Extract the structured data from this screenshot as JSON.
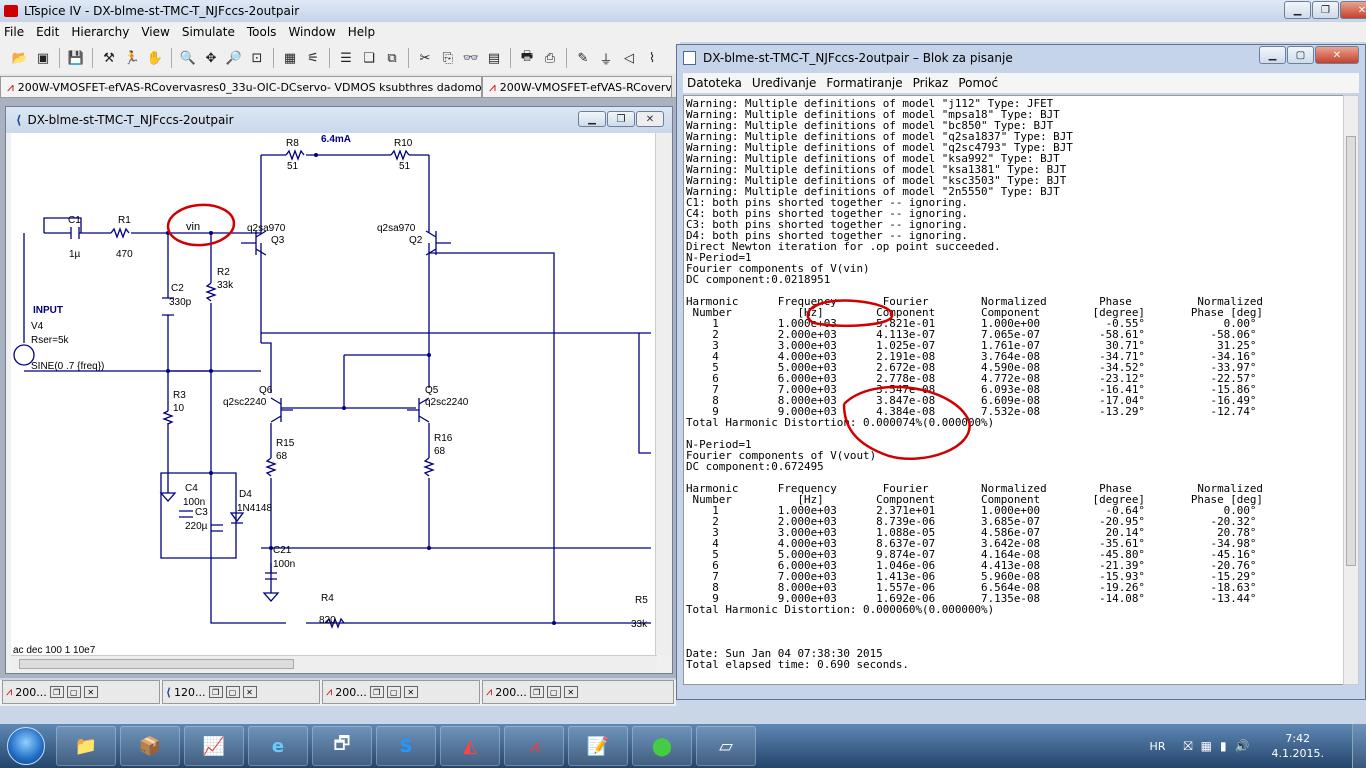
{
  "app": {
    "title": "LTspice IV - DX-blme-st-TMC-T_NJFccs-2outpair",
    "menu": [
      "File",
      "Edit",
      "Hierarchy",
      "View",
      "Simulate",
      "Tools",
      "Window",
      "Help"
    ]
  },
  "doc_tabs": [
    "200W-VMOSFET-efVAS-RCovervasres0_33u-OIC-DCservo- VDMOS ksubthres dadomodels[2]",
    "200W-VMOSFET-efVAS-RCoverv"
  ],
  "schematic": {
    "title": "DX-blme-st-TMC-T_NJFccs-2outpair",
    "labels": {
      "R8": "R8",
      "R8v": "51",
      "current": "6.4mA",
      "R10": "R10",
      "R10v": "51",
      "C1": "C1",
      "C1v": "1µ",
      "R1": "R1",
      "R1v": "470",
      "vin": "vin",
      "Q3m": "q2sa970",
      "Q3": "Q3",
      "Q2m": "q2sa970",
      "Q2": "Q2",
      "C2": "C2",
      "C2v": "330p",
      "R2": "R2",
      "R2v": "33k",
      "input": "INPUT",
      "V4": "V4",
      "rser": "Rser=5k",
      "sine": "SINE(0 .7 {freq})",
      "R3": "R3",
      "R3v": "10",
      "Q6": "Q6",
      "Q6m": "q2sc2240",
      "Q5": "Q5",
      "Q5m": "q2sc2240",
      "R15": "R15",
      "R15v": "68",
      "R16": "R16",
      "R16v": "68",
      "C4": "C4",
      "C4v": "100n",
      "C3": "C3",
      "C3v": "220µ",
      "D4": "D4",
      "D4m": "1N4148",
      "C21": "C21",
      "C21v": "100n",
      "R4": "R4",
      "R4v": "820",
      "R5": "R5",
      "R5v": "33k",
      "ac": "ac dec 100 1 10e7"
    }
  },
  "bottom_tabs": [
    "200...",
    "120...",
    "200...",
    "200..."
  ],
  "notepad": {
    "title": "DX-blme-st-TMC-T_NJFccs-2outpair – Blok za pisanje",
    "menu": [
      "Datoteka",
      "Uređivanje",
      "Formatiranje",
      "Prikaz",
      "Pomoć"
    ],
    "text": "Warning: Multiple definitions of model \"j112\" Type: JFET\nWarning: Multiple definitions of model \"mpsa18\" Type: BJT\nWarning: Multiple definitions of model \"bc850\" Type: BJT\nWarning: Multiple definitions of model \"q2sa1837\" Type: BJT\nWarning: Multiple definitions of model \"q2sc4793\" Type: BJT\nWarning: Multiple definitions of model \"ksa992\" Type: BJT\nWarning: Multiple definitions of model \"ksa1381\" Type: BJT\nWarning: Multiple definitions of model \"ksc3503\" Type: BJT\nWarning: Multiple definitions of model \"2n5550\" Type: BJT\nC1: both pins shorted together -- ignoring.\nC4: both pins shorted together -- ignoring.\nC3: both pins shorted together -- ignoring.\nD4: both pins shorted together -- ignoring.\nDirect Newton iteration for .op point succeeded.\nN-Period=1\nFourier components of V(vin)\nDC component:0.0218951\n\nHarmonic      Frequency       Fourier        Normalized        Phase          Normalized\n Number          [Hz]        Component       Component        [degree]       Phase [deg]\n    1         1.000e+03      5.821e-01       1.000e+00          -0.55°            0.00°\n    2         2.000e+03      4.113e-07       7.065e-07         -58.61°          -58.06°\n    3         3.000e+03      1.025e-07       1.761e-07          30.71°           31.25°\n    4         4.000e+03      2.191e-08       3.764e-08         -34.71°          -34.16°\n    5         5.000e+03      2.672e-08       4.590e-08         -34.52°          -33.97°\n    6         6.000e+03      2.778e-08       4.772e-08         -23.12°          -22.57°\n    7         7.000e+03      3.547e-08       6.093e-08         -16.41°          -15.86°\n    8         8.000e+03      3.847e-08       6.609e-08         -17.04°          -16.49°\n    9         9.000e+03      4.384e-08       7.532e-08         -13.29°          -12.74°\nTotal Harmonic Distortion: 0.000074%(0.000000%)\n\nN-Period=1\nFourier components of V(vout)\nDC component:0.672495\n\nHarmonic      Frequency       Fourier        Normalized        Phase          Normalized\n Number          [Hz]        Component       Component        [degree]       Phase [deg]\n    1         1.000e+03      2.371e+01       1.000e+00          -0.64°            0.00°\n    2         2.000e+03      8.739e-06       3.685e-07         -20.95°          -20.32°\n    3         3.000e+03      1.088e-05       4.586e-07          20.14°           20.78°\n    4         4.000e+03      8.637e-07       3.642e-08         -35.61°          -34.98°\n    5         5.000e+03      9.874e-07       4.164e-08         -45.80°          -45.16°\n    6         6.000e+03      1.046e-06       4.413e-08         -21.39°          -20.76°\n    7         7.000e+03      1.413e-06       5.960e-08         -15.93°          -15.29°\n    8         8.000e+03      1.557e-06       6.564e-08         -19.26°          -18.63°\n    9         9.000e+03      1.692e-06       7.135e-08         -14.08°          -13.44°\nTotal Harmonic Distortion: 0.000060%(0.000000%)\n\n\n\nDate: Sun Jan 04 07:38:30 2015\nTotal elapsed time: 0.690 seconds."
  },
  "taskbar": {
    "lang": "HR",
    "time": "7:42",
    "date": "4.1.2015."
  },
  "colors": {
    "wire": "#000080",
    "annotation": "#d00000",
    "component_text": "#000080"
  }
}
